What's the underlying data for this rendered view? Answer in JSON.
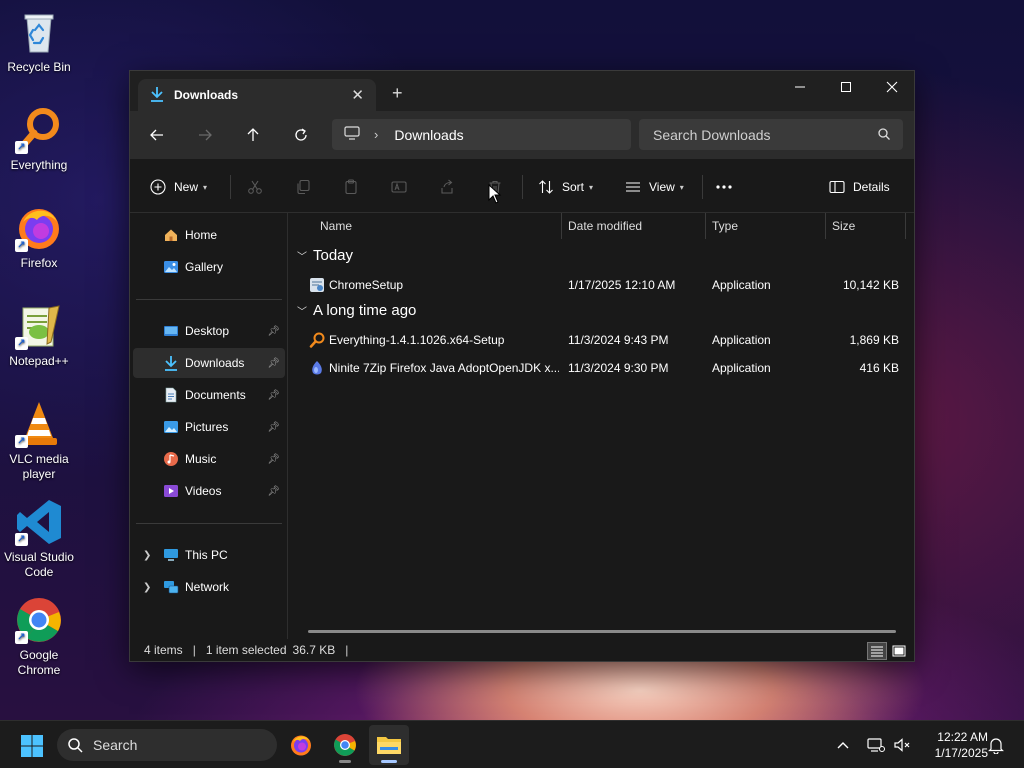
{
  "desktop": {
    "icons": [
      {
        "label": "Recycle Bin",
        "icon": "recycle-bin-icon"
      },
      {
        "label": "Everything",
        "icon": "everything-icon"
      },
      {
        "label": "Firefox",
        "icon": "firefox-icon"
      },
      {
        "label": "Notepad++",
        "icon": "notepad-plus-plus-icon"
      },
      {
        "label": "VLC media player",
        "icon": "vlc-icon"
      },
      {
        "label": "Visual Studio Code",
        "icon": "vscode-icon"
      },
      {
        "label": "Google Chrome",
        "icon": "chrome-icon"
      }
    ]
  },
  "window": {
    "tab_title": "Downloads",
    "address": {
      "crumb": "Downloads"
    },
    "search": {
      "placeholder": "Search Downloads"
    },
    "commands": {
      "new_label": "New",
      "sort_label": "Sort",
      "view_label": "View",
      "details_label": "Details"
    },
    "nav": {
      "home": "Home",
      "gallery": "Gallery",
      "desktop": "Desktop",
      "downloads": "Downloads",
      "documents": "Documents",
      "pictures": "Pictures",
      "music": "Music",
      "videos": "Videos",
      "this_pc": "This PC",
      "network": "Network"
    },
    "columns": {
      "name": "Name",
      "date": "Date modified",
      "type": "Type",
      "size": "Size"
    },
    "groups": [
      {
        "label": "Today",
        "files": [
          {
            "name": "ChromeSetup",
            "date": "1/17/2025 12:10 AM",
            "type": "Application",
            "size": "10,142 KB",
            "icon": "chrome-setup-icon"
          }
        ]
      },
      {
        "label": "A long time ago",
        "files": [
          {
            "name": "Everything-1.4.1.1026.x64-Setup",
            "date": "11/3/2024 9:43 PM",
            "type": "Application",
            "size": "1,869 KB",
            "icon": "everything-icon"
          },
          {
            "name": "Ninite 7Zip Firefox Java AdoptOpenJDK x...",
            "date": "11/3/2024 9:30 PM",
            "type": "Application",
            "size": "416 KB",
            "icon": "ninite-icon"
          }
        ]
      }
    ],
    "status": {
      "items": "4 items",
      "selected": "1 item selected",
      "size": "36.7 KB"
    }
  },
  "taskbar": {
    "search_placeholder": "Search",
    "time": "12:22 AM",
    "date": "1/17/2025"
  },
  "colors": {
    "window_bg": "#191919",
    "toolbar_bg": "#2c2c2c",
    "accent": "#4cc2ff",
    "folder_yellow": "#f5c842"
  }
}
